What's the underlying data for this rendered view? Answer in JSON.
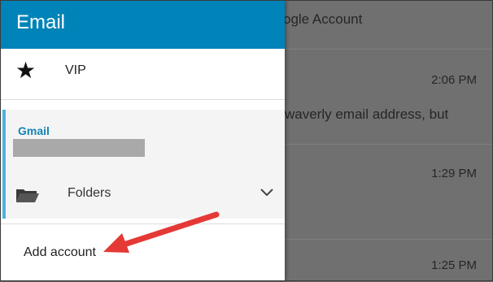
{
  "drawer": {
    "title": "Email",
    "vip": {
      "label": "VIP",
      "icon": "star-icon"
    },
    "account": {
      "name": "Gmail",
      "folders_label": "Folders",
      "folder_icon": "folder-icon",
      "expand_icon": "chevron-down-icon"
    },
    "add_account_label": "Add account"
  },
  "email_list": {
    "rows": [
      {
        "text": "ogle Account",
        "time": ""
      },
      {
        "text": "",
        "time": "2:06 PM"
      },
      {
        "text": "waverly email address, but",
        "time": ""
      },
      {
        "text": "",
        "time": "1:29 PM"
      },
      {
        "text": "",
        "time": "1:25 PM"
      }
    ]
  },
  "annotation": {
    "arrow_color": "#e53935"
  },
  "colors": {
    "header": "#0083b8",
    "accent": "#4db2dc",
    "account_name": "#1384b3"
  }
}
